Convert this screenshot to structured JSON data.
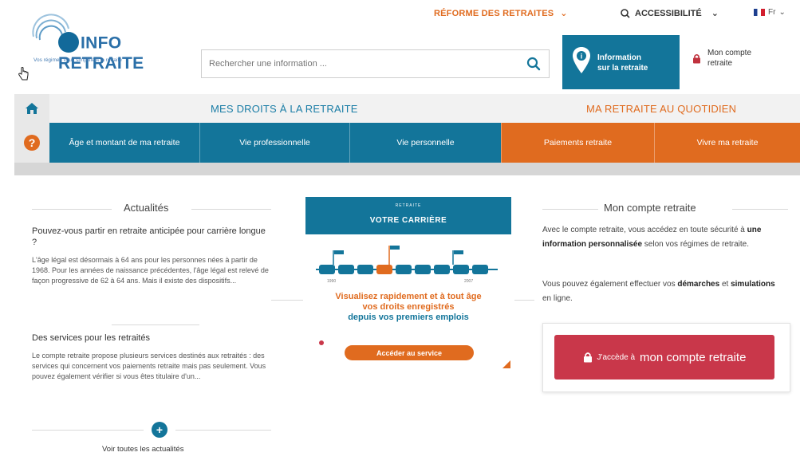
{
  "topbar": {
    "reforme": "RÉFORME DES RETRAITES",
    "accessibilite": "ACCESSIBILITÉ",
    "lang": "Fr"
  },
  "logo": {
    "brand": "INFO RETRAITE",
    "tagline": "Vos régimes vous simplifient la retraite"
  },
  "search": {
    "placeholder": "Rechercher une information ..."
  },
  "infobox": {
    "line1": "Information",
    "line2": "sur la retraite"
  },
  "moncompte": {
    "line1": "Mon compte",
    "line2": "retraite"
  },
  "nav": {
    "droits": "MES DROITS À LA RETRAITE",
    "quotidien": "MA RETRAITE AU QUOTIDIEN",
    "tabs": [
      {
        "label": "Âge et montant de ma retraite",
        "color": "#13759a"
      },
      {
        "label": "Vie professionnelle",
        "color": "#13759a"
      },
      {
        "label": "Vie personnelle",
        "color": "#13759a"
      },
      {
        "label": "Paiements retraite",
        "color": "#e06b1f"
      },
      {
        "label": "Vivre ma retraite",
        "color": "#e06b1f"
      }
    ]
  },
  "actualites": {
    "title": "Actualités",
    "q1": "Pouvez-vous partir en retraite anticipée pour carrière longue ?",
    "p1": "L'âge légal est désormais à 64 ans pour les personnes nées à partir de 1968. Pour les années de naissance précédentes, l'âge légal est relevé de façon progressive de 62 à 64 ans. Mais il existe des dispositifs...",
    "q2": "Des services pour les retraités",
    "p2": "Le compte retraite propose plusieurs services destinés aux retraités : des services qui concernent vos paiements retraite mais pas seulement. Vous pouvez également vérifier si vous êtes titulaire d'un...",
    "voir": "Voir toutes les actualités"
  },
  "carriere": {
    "small": "RETRAITE",
    "title": "VOTRE CARRIÈRE",
    "line1": "Visualisez rapidement et à tout âge",
    "line2": "vos droits enregistrés",
    "line3": "depuis vos premiers emplois",
    "button": "Accéder au service"
  },
  "compte": {
    "title": "Mon compte retraite",
    "r1_a": "Avec le compte retraite, vous accédez en toute sécurité à ",
    "r1_b": "une information personnalisée",
    "r1_c": " selon vos régimes de retraite.",
    "r2_a": "Vous pouvez également effectuer vos ",
    "r2_b": "démarches",
    "r2_c": " et ",
    "r2_d": "simulations",
    "r2_e": " en ligne.",
    "cta_small": "J'accède à",
    "cta_big": "mon compte retraite"
  },
  "colors": {
    "primary": "#13759a",
    "accent": "#e06b1f",
    "cta": "#c9374a"
  }
}
